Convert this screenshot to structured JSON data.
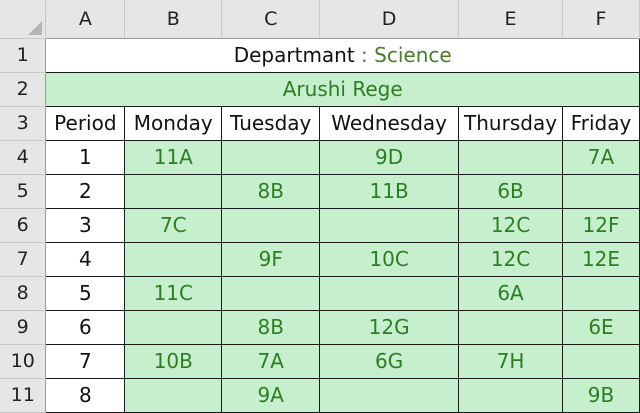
{
  "columns": [
    "A",
    "B",
    "C",
    "D",
    "E",
    "F"
  ],
  "row_numbers": [
    "1",
    "2",
    "3",
    "4",
    "5",
    "6",
    "7",
    "8",
    "9",
    "10",
    "11"
  ],
  "department": {
    "label": "Departmant",
    "separator": " : ",
    "value": "Science"
  },
  "teacher": "Arushi Rege",
  "header": [
    "Period",
    "Monday",
    "Tuesday",
    "Wednesday",
    "Thursday",
    "Friday"
  ],
  "timetable": [
    {
      "period": "1",
      "classes": [
        "11A",
        "",
        "9D",
        "",
        "7A"
      ]
    },
    {
      "period": "2",
      "classes": [
        "",
        "8B",
        "11B",
        "6B",
        ""
      ]
    },
    {
      "period": "3",
      "classes": [
        "7C",
        "",
        "",
        "12C",
        "12F"
      ]
    },
    {
      "period": "4",
      "classes": [
        "",
        "9F",
        "10C",
        "12C",
        "12E"
      ]
    },
    {
      "period": "5",
      "classes": [
        "11C",
        "",
        "",
        "6A",
        ""
      ]
    },
    {
      "period": "6",
      "classes": [
        "",
        "8B",
        "12G",
        "",
        "6E"
      ]
    },
    {
      "period": "7",
      "classes": [
        "10B",
        "7A",
        "6G",
        "7H",
        ""
      ]
    },
    {
      "period": "8",
      "classes": [
        "",
        "9A",
        "",
        "",
        "9B"
      ]
    }
  ],
  "colors": {
    "fill_green": "#c6efce",
    "text_green": "#2e7d22",
    "header_gray": "#e6e6e6"
  }
}
